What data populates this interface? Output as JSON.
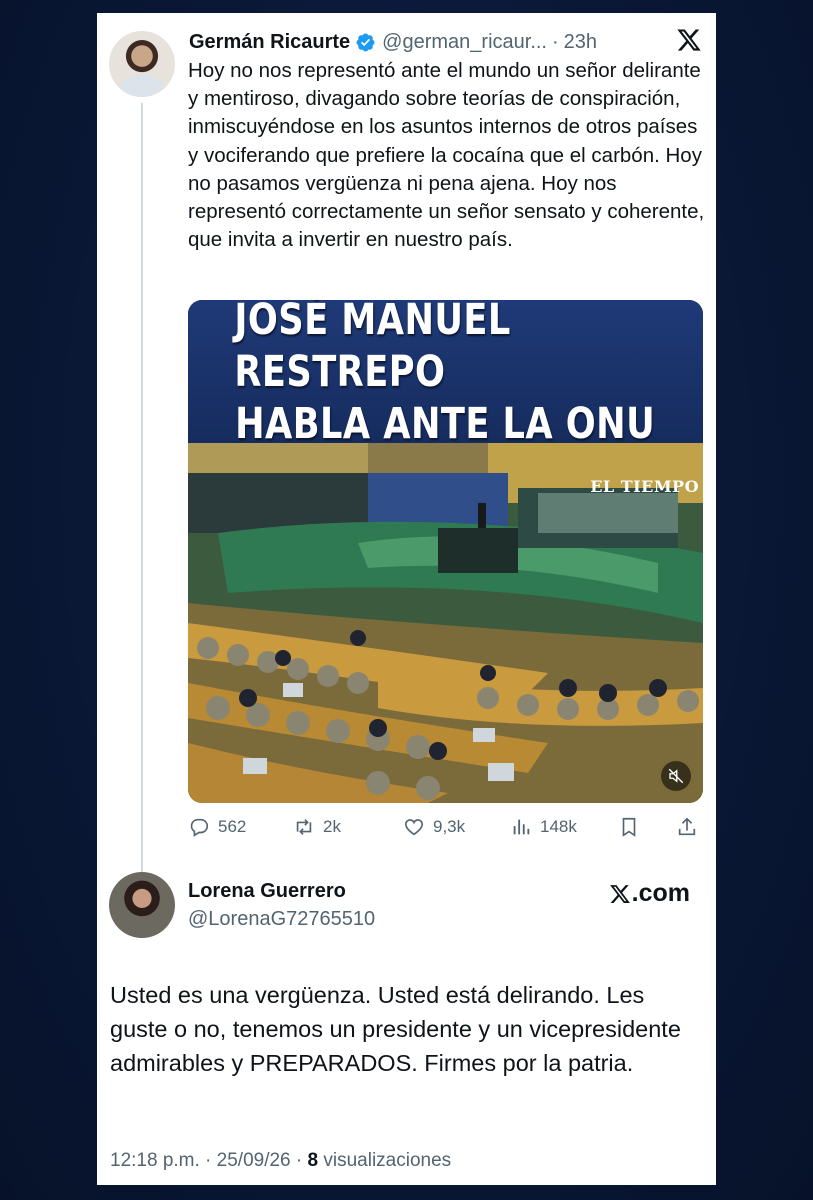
{
  "tweet": {
    "author_name": "Germán Ricaurte",
    "handle": "@german_ricaur...",
    "separator": "·",
    "time": "23h",
    "text": "Hoy no nos representó ante el mundo un señor delirante y mentiroso, divagando sobre teorías de conspiración, inmiscuyéndose en los asuntos internos de otros países y vociferando que prefiere la cocaína que el carbón. Hoy no pasamos vergüenza ni pena ajena. Hoy nos representó correctamente un señor sensato y coherente, que invita a invertir en nuestro país.",
    "media": {
      "headline_line1": "JOSÉ MANUEL RESTREPO",
      "headline_line2": "HABLA ANTE LA ONU",
      "watermark": "EL TIEMPO"
    },
    "actions": {
      "replies": "562",
      "reposts": "2k",
      "likes": "9,3k",
      "views": "148k"
    }
  },
  "reply": {
    "author_name": "Lorena Guerrero",
    "handle": "@LorenaG72765510",
    "site_label": ".com",
    "text": "Usted es una vergüenza. Usted está delirando. Les guste o no, tenemos un presidente y un vicepresidente admirables y PREPARADOS. Firmes por la patria.",
    "timestamp": "12:18 p.m. · 25/09/26 · ",
    "view_count": "8",
    "views_label": " visualizaciones"
  },
  "colors": {
    "background": "#0b1a3a",
    "card": "#ffffff",
    "verified_blue": "#1d9bf0",
    "secondary_text": "#536471"
  },
  "icons": [
    "verified-badge-icon",
    "x-logo-icon",
    "reply-icon",
    "repost-icon",
    "like-icon",
    "views-icon",
    "bookmark-icon",
    "share-icon",
    "mute-icon"
  ]
}
